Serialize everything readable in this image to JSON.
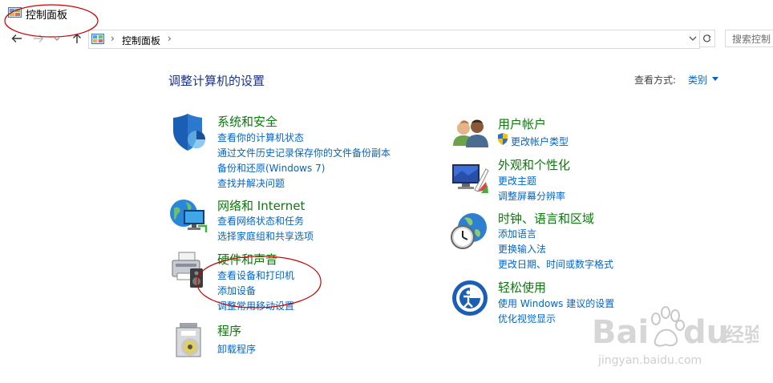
{
  "window": {
    "title": "控制面板"
  },
  "address": {
    "crumb": "控制面板",
    "sep": "›",
    "search_placeholder": "搜索控制"
  },
  "header": {
    "title": "调整计算机的设置",
    "view_by_label": "查看方式:",
    "view_by_value": "类别"
  },
  "categories": [
    {
      "title": "系统和安全",
      "links": [
        "查看你的计算机状态",
        "通过文件历史记录保存你的文件备份副本",
        "备份和还原(Windows 7)",
        "查找并解决问题"
      ]
    },
    {
      "title": "网络和 Internet",
      "links": [
        "查看网络状态和任务",
        "选择家庭组和共享选项"
      ]
    },
    {
      "title": "硬件和声音",
      "links": [
        "查看设备和打印机",
        "添加设备",
        "调整常用移动设置"
      ]
    },
    {
      "title": "程序",
      "links": [
        "卸载程序"
      ]
    },
    {
      "title": "用户帐户",
      "links": [
        "更改帐户类型"
      ]
    },
    {
      "title": "外观和个性化",
      "links": [
        "更改主题",
        "调整屏幕分辨率"
      ]
    },
    {
      "title": "时钟、语言和区域",
      "links": [
        "添加语言",
        "更换输入法",
        "更改日期、时间或数字格式"
      ]
    },
    {
      "title": "轻松使用",
      "links": [
        "使用 Windows 建议的设置",
        "优化视觉显示"
      ]
    }
  ],
  "watermark": {
    "brand": "Bai du",
    "brand_cn": "经验",
    "url": "jingyan.baidu.com"
  },
  "colors": {
    "title_blue": "#1e3287",
    "category_green": "#0a7a0a",
    "link_blue": "#0066cc",
    "annotation_red": "#cc0000"
  }
}
